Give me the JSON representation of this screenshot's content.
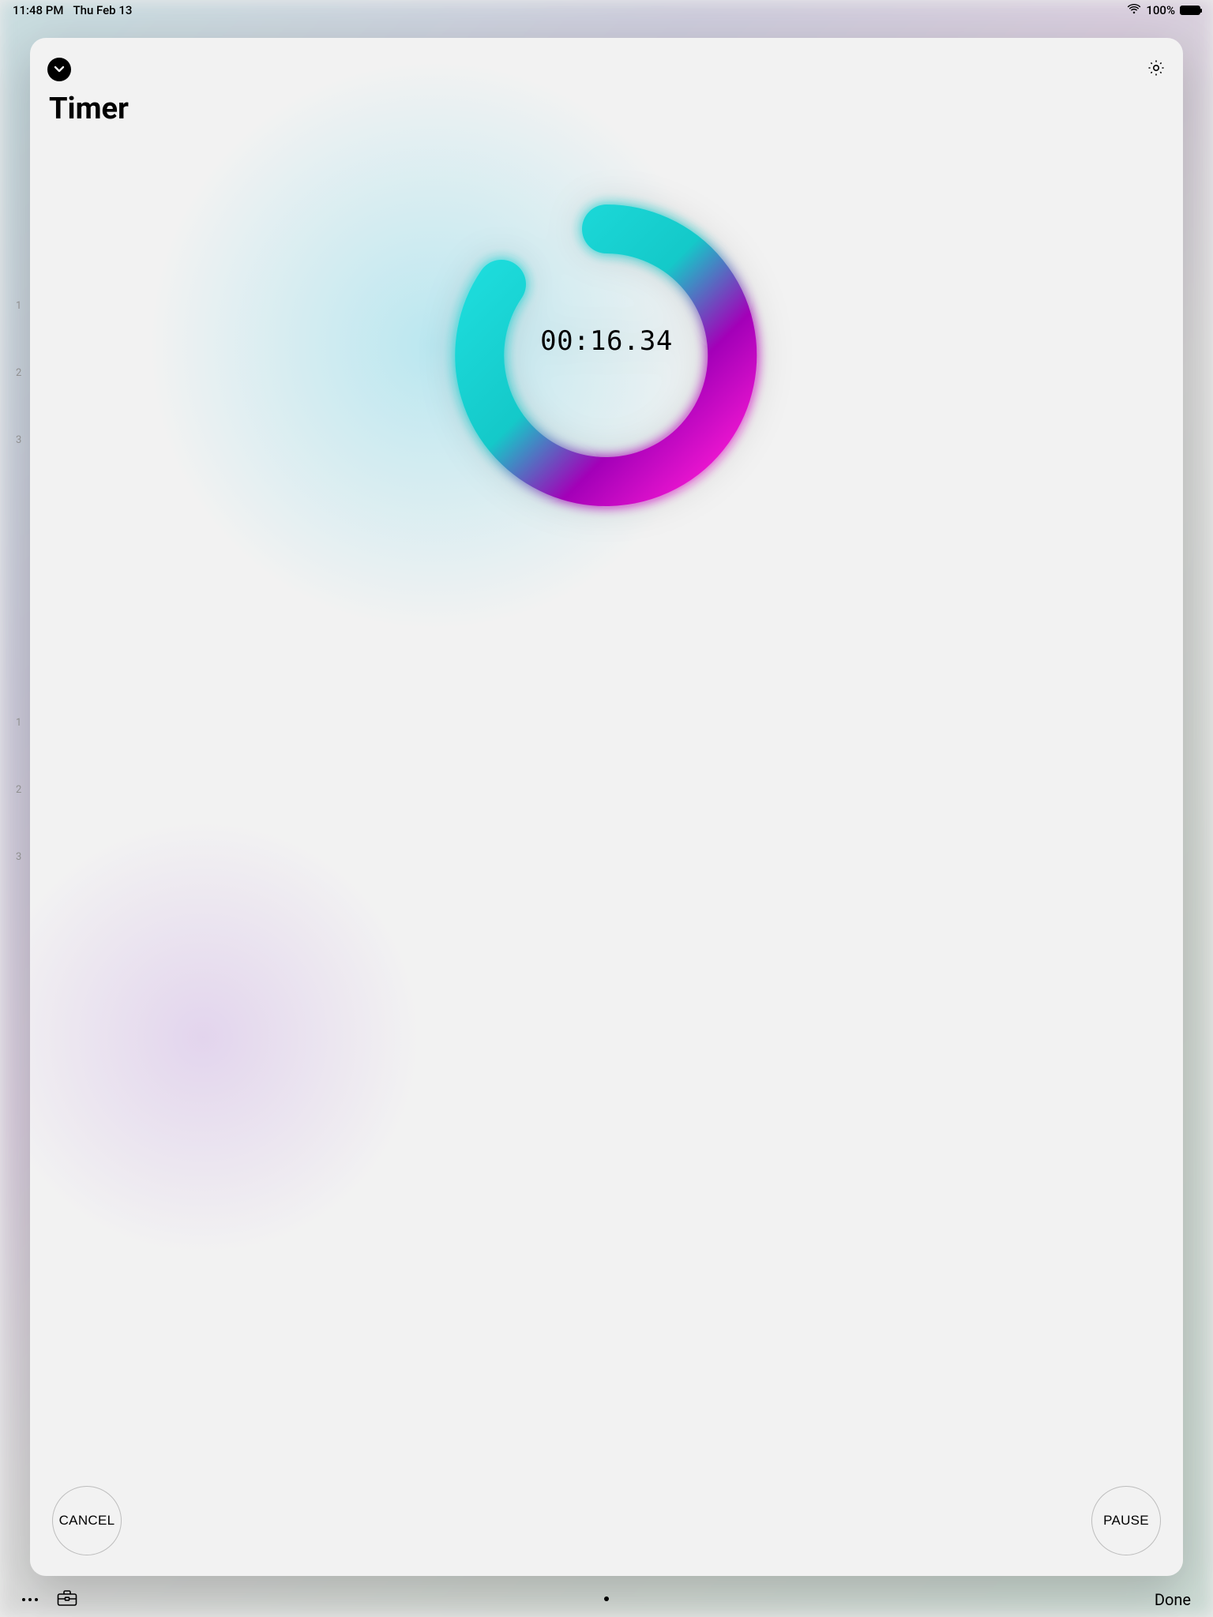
{
  "status_bar": {
    "time": "11:48 PM",
    "date": "Thu Feb 13",
    "battery_pct": "100%",
    "wifi_icon": "wifi"
  },
  "page_title": "Timer",
  "timer": {
    "readout": "00:16.34"
  },
  "controls": {
    "cancel_label": "CANCEL",
    "pause_label": "PAUSE"
  },
  "bottom_bar": {
    "done_label": "Done"
  }
}
